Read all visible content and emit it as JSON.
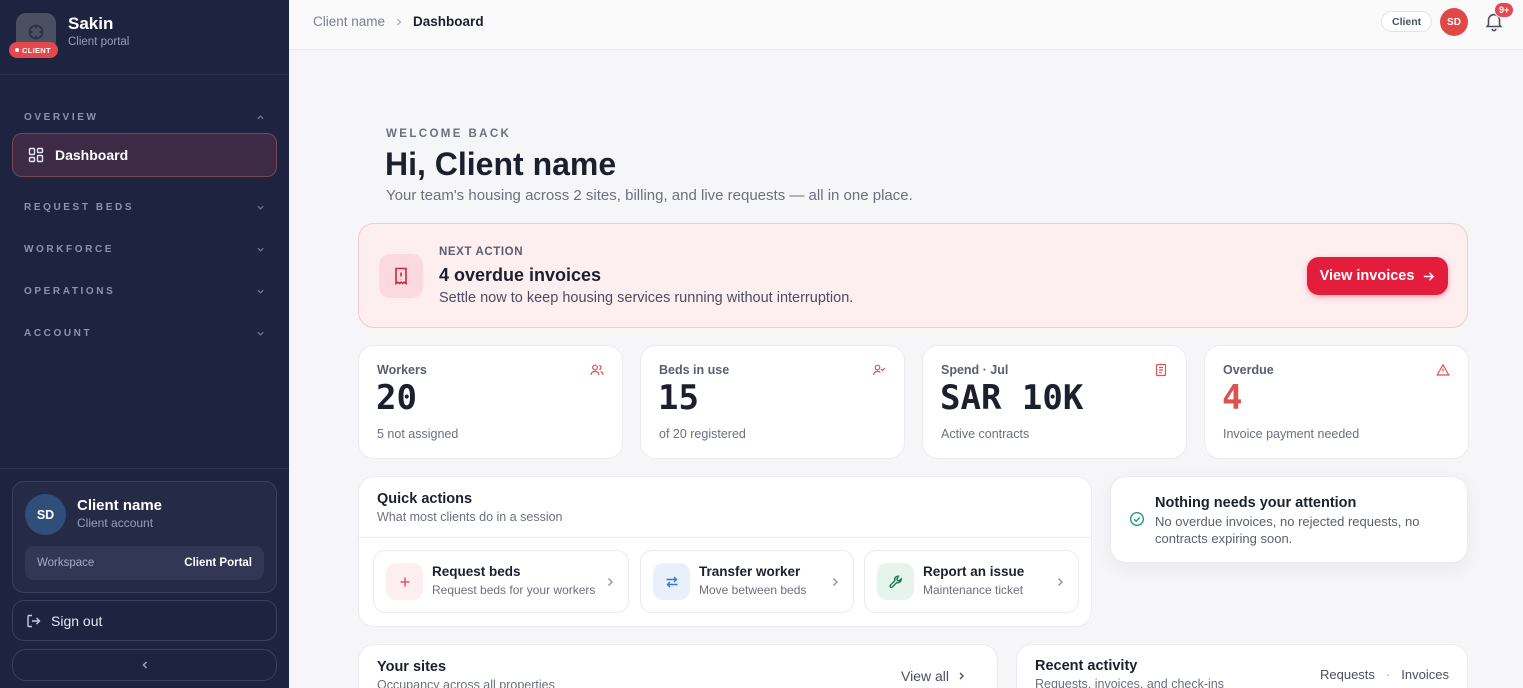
{
  "brand": {
    "name": "Sakin",
    "subtitle": "Client portal",
    "badge": "CLIENT"
  },
  "nav": {
    "sections": [
      {
        "label": "OVERVIEW",
        "expanded": true
      },
      {
        "label": "REQUEST BEDS",
        "expanded": false
      },
      {
        "label": "WORKFORCE",
        "expanded": false
      },
      {
        "label": "OPERATIONS",
        "expanded": false
      },
      {
        "label": "ACCOUNT",
        "expanded": false
      }
    ],
    "active_item": {
      "label": "Dashboard",
      "icon": "grid-icon"
    }
  },
  "profile": {
    "initials": "SD",
    "name": "Client name",
    "role": "Client account",
    "workspace_label": "Workspace",
    "workspace_value": "Client Portal",
    "sign_out": "Sign out"
  },
  "topbar": {
    "breadcrumb": [
      "Client name",
      "Dashboard"
    ],
    "role_chip": "Client",
    "avatar_initials": "SD",
    "notification_badge": "9+"
  },
  "welcome": {
    "eyebrow": "WELCOME BACK",
    "title": "Hi, Client name",
    "subtitle": "Your team's housing across 2 sites, billing, and live requests — all in one place."
  },
  "alert": {
    "eyebrow": "NEXT ACTION",
    "title": "4 overdue invoices",
    "subtitle": "Settle now to keep housing services running without interruption.",
    "button": "View invoices"
  },
  "stats": [
    {
      "label": "Workers",
      "value": "20",
      "sub": "5 not assigned",
      "icon": "users-icon"
    },
    {
      "label": "Beds in use",
      "value": "15",
      "sub": "of 20 registered",
      "icon": "user-check-icon"
    },
    {
      "label": "Spend · Jul",
      "value": "SAR 10K",
      "sub": "Active contracts",
      "icon": "receipt-icon"
    },
    {
      "label": "Overdue",
      "value": "4",
      "sub": "Invoice payment needed",
      "icon": "warning-icon"
    }
  ],
  "quick_actions": {
    "title": "Quick actions",
    "subtitle": "What most clients do in a session",
    "items": [
      {
        "title": "Request beds",
        "sub": "Request beds for your workers",
        "icon": "plus-icon"
      },
      {
        "title": "Transfer worker",
        "sub": "Move between beds",
        "icon": "transfer-icon"
      },
      {
        "title": "Report an issue",
        "sub": "Maintenance ticket",
        "icon": "wrench-icon"
      }
    ]
  },
  "attention": {
    "title": "Nothing needs your attention",
    "body": "No overdue invoices, no rejected requests, no contracts expiring soon."
  },
  "sites": {
    "title": "Your sites",
    "subtitle": "Occupancy across all properties",
    "link": "View all"
  },
  "activity": {
    "title": "Recent activity",
    "subtitle": "Requests, invoices, and check-ins",
    "tabs": [
      "Requests",
      "Invoices"
    ],
    "separator": "·"
  },
  "colors": {
    "sidebar": "#1e2340",
    "accent": "#e41d3c",
    "danger_text": "#d9534f",
    "success": "#1f9e6e"
  }
}
